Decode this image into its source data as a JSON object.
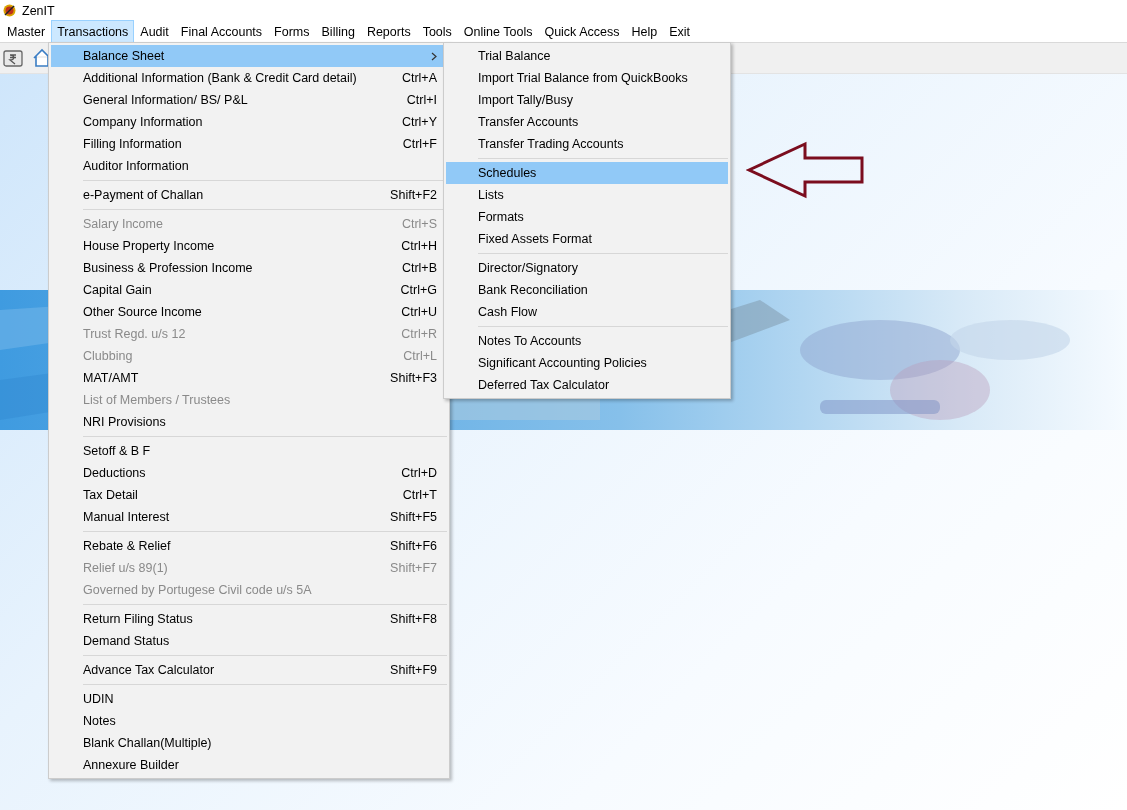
{
  "window": {
    "title": "ZenIT"
  },
  "menu_bar": [
    {
      "label": "Master",
      "selected": false
    },
    {
      "label": "Transactions",
      "selected": true
    },
    {
      "label": "Audit",
      "selected": false
    },
    {
      "label": "Final Accounts",
      "selected": false
    },
    {
      "label": "Forms",
      "selected": false
    },
    {
      "label": "Billing",
      "selected": false
    },
    {
      "label": "Reports",
      "selected": false
    },
    {
      "label": "Tools",
      "selected": false
    },
    {
      "label": "Online Tools",
      "selected": false
    },
    {
      "label": "Quick Access",
      "selected": false
    },
    {
      "label": "Help",
      "selected": false
    },
    {
      "label": "Exit",
      "selected": false
    }
  ],
  "transactions_menu": [
    [
      {
        "label": "Balance Sheet",
        "selected": true,
        "has_submenu": true,
        "disabled": false
      },
      {
        "label": "Additional Information (Bank & Credit Card detail)",
        "shortcut": "Ctrl+A",
        "selected": false,
        "has_submenu": false,
        "disabled": false
      },
      {
        "label": "General Information/ BS/ P&L",
        "shortcut": "Ctrl+I",
        "selected": false,
        "has_submenu": false,
        "disabled": false
      },
      {
        "label": "Company Information",
        "shortcut": "Ctrl+Y",
        "selected": false,
        "has_submenu": false,
        "disabled": false
      },
      {
        "label": "Filling Information",
        "shortcut": "Ctrl+F",
        "selected": false,
        "has_submenu": false,
        "disabled": false
      },
      {
        "label": "Auditor Information",
        "selected": false,
        "has_submenu": false,
        "disabled": false
      }
    ],
    [
      {
        "label": "e-Payment of Challan",
        "shortcut": "Shift+F2",
        "selected": false,
        "has_submenu": false,
        "disabled": false
      }
    ],
    [
      {
        "label": "Salary Income",
        "shortcut": "Ctrl+S",
        "selected": false,
        "has_submenu": false,
        "disabled": true
      },
      {
        "label": "House Property Income",
        "shortcut": "Ctrl+H",
        "selected": false,
        "has_submenu": false,
        "disabled": false
      },
      {
        "label": "Business & Profession Income",
        "shortcut": "Ctrl+B",
        "selected": false,
        "has_submenu": false,
        "disabled": false
      },
      {
        "label": "Capital Gain",
        "shortcut": "Ctrl+G",
        "selected": false,
        "has_submenu": false,
        "disabled": false
      },
      {
        "label": "Other Source Income",
        "shortcut": "Ctrl+U",
        "selected": false,
        "has_submenu": false,
        "disabled": false
      },
      {
        "label": "Trust Regd. u/s 12",
        "shortcut": "Ctrl+R",
        "selected": false,
        "has_submenu": false,
        "disabled": true
      },
      {
        "label": "Clubbing",
        "shortcut": "Ctrl+L",
        "selected": false,
        "has_submenu": false,
        "disabled": true
      },
      {
        "label": "MAT/AMT",
        "shortcut": "Shift+F3",
        "selected": false,
        "has_submenu": false,
        "disabled": false
      },
      {
        "label": "List of Members / Trustees",
        "selected": false,
        "has_submenu": false,
        "disabled": true
      },
      {
        "label": "NRI Provisions",
        "selected": false,
        "has_submenu": false,
        "disabled": false
      }
    ],
    [
      {
        "label": "Setoff & B F",
        "selected": false,
        "has_submenu": false,
        "disabled": false
      },
      {
        "label": "Deductions",
        "shortcut": "Ctrl+D",
        "selected": false,
        "has_submenu": false,
        "disabled": false
      },
      {
        "label": "Tax Detail",
        "shortcut": "Ctrl+T",
        "selected": false,
        "has_submenu": false,
        "disabled": false
      },
      {
        "label": "Manual Interest",
        "shortcut": "Shift+F5",
        "selected": false,
        "has_submenu": false,
        "disabled": false
      }
    ],
    [
      {
        "label": "Rebate & Relief",
        "shortcut": "Shift+F6",
        "selected": false,
        "has_submenu": false,
        "disabled": false
      },
      {
        "label": "Relief u/s 89(1)",
        "shortcut": "Shift+F7",
        "selected": false,
        "has_submenu": false,
        "disabled": true
      },
      {
        "label": "Governed by Portugese Civil code u/s 5A",
        "selected": false,
        "has_submenu": false,
        "disabled": true
      }
    ],
    [
      {
        "label": "Return Filing Status",
        "shortcut": "Shift+F8",
        "selected": false,
        "has_submenu": false,
        "disabled": false
      },
      {
        "label": "Demand Status",
        "selected": false,
        "has_submenu": false,
        "disabled": false
      }
    ],
    [
      {
        "label": "Advance Tax Calculator",
        "shortcut": "Shift+F9",
        "selected": false,
        "has_submenu": false,
        "disabled": false
      }
    ],
    [
      {
        "label": "UDIN",
        "selected": false,
        "has_submenu": false,
        "disabled": false
      },
      {
        "label": "Notes",
        "selected": false,
        "has_submenu": false,
        "disabled": false
      },
      {
        "label": "Blank Challan(Multiple)",
        "selected": false,
        "has_submenu": false,
        "disabled": false
      },
      {
        "label": "Annexure Builder",
        "selected": false,
        "has_submenu": false,
        "disabled": false
      }
    ]
  ],
  "balance_sheet_menu": [
    [
      {
        "label": "Trial Balance",
        "selected": false
      },
      {
        "label": "Import Trial Balance from QuickBooks",
        "selected": false
      },
      {
        "label": "Import Tally/Busy",
        "selected": false
      },
      {
        "label": "Transfer Accounts",
        "selected": false
      },
      {
        "label": "Transfer Trading Accounts",
        "selected": false
      }
    ],
    [
      {
        "label": "Schedules",
        "selected": true
      },
      {
        "label": "Lists",
        "selected": false
      },
      {
        "label": "Formats",
        "selected": false
      },
      {
        "label": "Fixed Assets Format",
        "selected": false
      }
    ],
    [
      {
        "label": "Director/Signatory",
        "selected": false
      },
      {
        "label": "Bank Reconciliation",
        "selected": false
      },
      {
        "label": "Cash Flow",
        "selected": false
      }
    ],
    [
      {
        "label": "Notes To Accounts",
        "selected": false
      },
      {
        "label": "Significant Accounting Policies",
        "selected": false
      },
      {
        "label": "Deferred Tax Calculator",
        "selected": false
      }
    ]
  ],
  "banner": {
    "kind": "picture"
  }
}
